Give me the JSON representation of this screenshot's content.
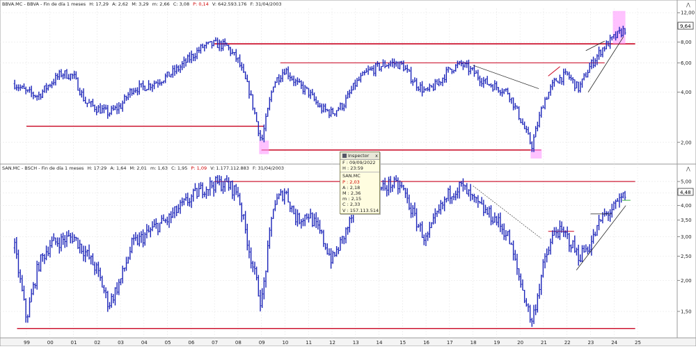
{
  "top_panel": {
    "title_prefix": "BBVA.MC - BBVA - Fin de día 1 meses",
    "hi": "H: 17,29",
    "a": "A: 2,62",
    "m": "M: 3,29",
    "mi": "m: 2,66",
    "c": "C: 3,08",
    "p": "P: 0,14",
    "v": "V: 642.593.176",
    "f": "F: 31/04/2003",
    "price_tag": "9,64",
    "yticks": [
      {
        "label": "12,00",
        "value": 12
      },
      {
        "label": "8,00",
        "value": 8
      },
      {
        "label": "6,00",
        "value": 6
      },
      {
        "label": "4,00",
        "value": 4
      },
      {
        "label": "2,00",
        "value": 2
      }
    ]
  },
  "bottom_panel": {
    "title_prefix": "SAN.MC - BSCH - Fin de día 1 meses",
    "hi": "H: 17:29",
    "a": "A: 1,64",
    "m": "M: 2,01",
    "mi": "m: 1,63",
    "c": "C: 1,95",
    "p": "P: 1,09",
    "v": "V: 1.177.112.883",
    "f": "F: 31/04/2003",
    "price_tag": "4,48",
    "yticks": [
      {
        "label": "5,00",
        "value": 5.0
      },
      {
        "label": "4,50",
        "value": 4.5
      },
      {
        "label": "4,00",
        "value": 4.0
      },
      {
        "label": "3,50",
        "value": 3.5
      },
      {
        "label": "3,00",
        "value": 3.0
      },
      {
        "label": "2,50",
        "value": 2.5
      },
      {
        "label": "2,00",
        "value": 2.0
      },
      {
        "label": "1,50",
        "value": 1.5
      }
    ]
  },
  "x_ticks": [
    "99",
    "00",
    "01",
    "02",
    "03",
    "04",
    "05",
    "06",
    "07",
    "08",
    "09",
    "10",
    "11",
    "12",
    "13",
    "14",
    "15",
    "16",
    "17",
    "18",
    "19",
    "20",
    "21",
    "22",
    "23",
    "24",
    "25"
  ],
  "inspector": {
    "title": "Inspector",
    "close": "x",
    "f": "F : 09/09/2022",
    "h": "H : 23:59",
    "symbol": "SAN.MC",
    "p": "P : 2,03",
    "a": "A : 2,18",
    "m": "M : 2,36",
    "mi": "m : 2,15",
    "c": "C : 2,33",
    "v": "V : 157.113.514"
  },
  "colors": {
    "candles": "#1a23b8",
    "levels": "#c8001e",
    "highlight": "#ff99ff",
    "trend": "#222222",
    "grid": "#e6e6e6"
  },
  "chart_data": [
    {
      "type": "line",
      "title": "BBVA.MC - BBVA - Fin de día 1 meses",
      "scale": "log",
      "ylim": [
        1.6,
        12.5
      ],
      "x": [
        1998.5,
        1999.0,
        1999.5,
        2000.0,
        2000.5,
        2001.0,
        2001.5,
        2002.0,
        2002.5,
        2003.0,
        2003.5,
        2004.0,
        2004.5,
        2005.0,
        2005.5,
        2006.0,
        2006.5,
        2007.0,
        2007.5,
        2008.0,
        2008.5,
        2009.0,
        2009.5,
        2010.0,
        2010.5,
        2011.0,
        2011.5,
        2012.0,
        2012.5,
        2013.0,
        2013.5,
        2014.0,
        2014.5,
        2015.0,
        2015.5,
        2016.0,
        2016.5,
        2017.0,
        2017.5,
        2018.0,
        2018.5,
        2019.0,
        2019.5,
        2020.0,
        2020.5,
        2021.0,
        2021.5,
        2022.0,
        2022.5,
        2023.0,
        2023.5,
        2024.0,
        2024.5
      ],
      "y": [
        4.5,
        4.0,
        3.8,
        4.5,
        5.2,
        5.0,
        3.5,
        3.2,
        3.0,
        3.3,
        4.2,
        4.3,
        4.6,
        5.0,
        5.6,
        6.5,
        7.5,
        7.8,
        7.6,
        6.2,
        4.0,
        2.0,
        4.5,
        5.5,
        4.5,
        4.0,
        3.2,
        3.0,
        3.4,
        4.5,
        5.3,
        5.7,
        6.0,
        5.8,
        4.6,
        4.0,
        4.5,
        5.5,
        5.9,
        5.3,
        4.6,
        4.3,
        4.0,
        2.8,
        1.9,
        3.5,
        4.7,
        5.1,
        4.2,
        5.8,
        7.3,
        8.5,
        9.64
      ],
      "levels": [
        2.5,
        1.8,
        7.8,
        6.0
      ],
      "last": 9.64
    },
    {
      "type": "line",
      "title": "SAN.MC - BSCH - Fin de día 1 meses",
      "scale": "log",
      "ylim": [
        1.22,
        5.3
      ],
      "x": [
        1998.5,
        1999.0,
        1999.5,
        2000.0,
        2000.5,
        2001.0,
        2001.5,
        2002.0,
        2002.5,
        2003.0,
        2003.5,
        2004.0,
        2004.5,
        2005.0,
        2005.5,
        2006.0,
        2006.5,
        2007.0,
        2007.5,
        2008.0,
        2008.5,
        2009.0,
        2009.5,
        2010.0,
        2010.5,
        2011.0,
        2011.5,
        2012.0,
        2012.5,
        2013.0,
        2013.5,
        2014.0,
        2014.5,
        2015.0,
        2015.5,
        2016.0,
        2016.5,
        2017.0,
        2017.5,
        2018.0,
        2018.5,
        2019.0,
        2019.5,
        2020.0,
        2020.5,
        2021.0,
        2021.5,
        2022.0,
        2022.5,
        2023.0,
        2023.5,
        2024.0,
        2024.5
      ],
      "y": [
        2.7,
        1.4,
        2.3,
        2.8,
        2.9,
        3.0,
        2.6,
        2.2,
        1.6,
        2.0,
        2.8,
        3.0,
        3.3,
        3.5,
        3.9,
        4.3,
        4.7,
        4.9,
        4.9,
        4.5,
        2.6,
        1.6,
        4.0,
        4.6,
        3.5,
        3.7,
        3.1,
        2.4,
        3.0,
        3.9,
        4.5,
        4.6,
        4.9,
        4.7,
        3.6,
        2.9,
        3.7,
        4.5,
        4.8,
        4.2,
        3.8,
        3.5,
        3.0,
        2.0,
        1.35,
        2.3,
        3.2,
        3.0,
        2.5,
        2.8,
        3.6,
        3.9,
        4.48
      ],
      "levels": [
        5.0,
        1.28
      ],
      "last": 4.48
    }
  ]
}
